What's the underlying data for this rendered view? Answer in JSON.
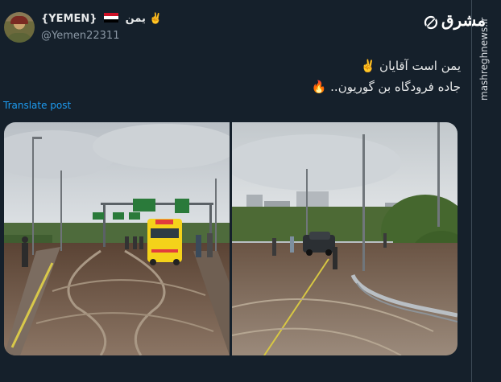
{
  "author": {
    "display_name_prefix": "{YEMEN}",
    "display_name_suffix": "یمن ✌️",
    "handle": "@Yemen22311",
    "flag_colors": [
      "#ce1126",
      "#ffffff",
      "#000000"
    ]
  },
  "brand": {
    "logo_text": "مشرق",
    "side_url": "mashreghnews.ir"
  },
  "tweet": {
    "line1": "یمن است آقایان ✌️",
    "line2": "جاده فرودگاه بن گوریون.. 🔥",
    "translate_label": "Translate post"
  },
  "media": {
    "photo_count": 2,
    "left_photo": {
      "sign_colors": [
        "#2a7a3a"
      ],
      "vehicle": "ambulance"
    },
    "right_photo": {
      "vehicle": "suv"
    }
  },
  "colors": {
    "background": "#15202b",
    "link": "#1d9bf0",
    "secondary_text": "#8b98a5"
  }
}
